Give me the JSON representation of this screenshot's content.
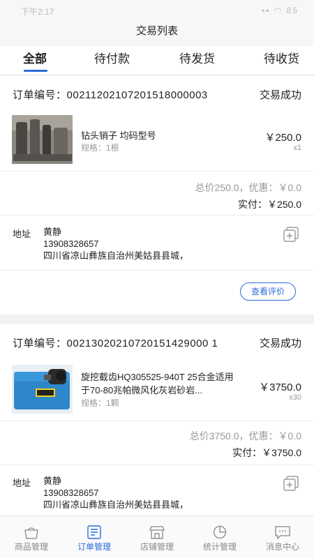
{
  "status_bar": {
    "time": "下午2:17",
    "right": "▪▪ ◠ 85"
  },
  "header": {
    "title": "交易列表"
  },
  "tabs": [
    {
      "label": "全部",
      "active": true
    },
    {
      "label": "待付款",
      "active": false
    },
    {
      "label": "待发货",
      "active": false
    },
    {
      "label": "待收货",
      "active": false
    }
  ],
  "orders": [
    {
      "order_no_label": "订单编号：",
      "order_no": "00211202107201518000003",
      "status": "交易成功",
      "product_name": "钻头销子 均码型号",
      "spec": "规格：1根",
      "price": "￥250.0",
      "qty": "x1",
      "total_line": "总价250.0，优惠：￥0.0",
      "paid_line": "实付：￥250.0",
      "address_label": "地址",
      "recipient": "黄静",
      "phone": "13908328657",
      "address": "四川省凉山彝族自治州美姑县县城，",
      "review_button": "查看评价"
    },
    {
      "order_no_label": "订单编号：",
      "order_no": "00213020210720151429000 1",
      "status": "交易成功",
      "product_name": "旋挖截齿HQ305525-940T 25合金适用于70-80兆帕微风化灰岩砂岩...",
      "spec": "规格：1颗",
      "price": "￥3750.0",
      "qty": "x30",
      "total_line": "总价3750.0，优惠：￥0.0",
      "paid_line": "实付：￥3750.0",
      "address_label": "地址",
      "recipient": "黄静",
      "phone": "13908328657",
      "address": "四川省凉山彝族自治州美姑县县城，"
    }
  ],
  "bottom_nav": [
    {
      "label": "商品管理",
      "icon": "bag-icon",
      "active": false
    },
    {
      "label": "订单管理",
      "icon": "order-list-icon",
      "active": true
    },
    {
      "label": "店铺管理",
      "icon": "store-icon",
      "active": false
    },
    {
      "label": "统计管理",
      "icon": "pie-chart-icon",
      "active": false
    },
    {
      "label": "消息中心",
      "icon": "message-icon",
      "active": false
    }
  ],
  "colors": {
    "accent": "#2a6cdc",
    "muted": "#999999"
  }
}
